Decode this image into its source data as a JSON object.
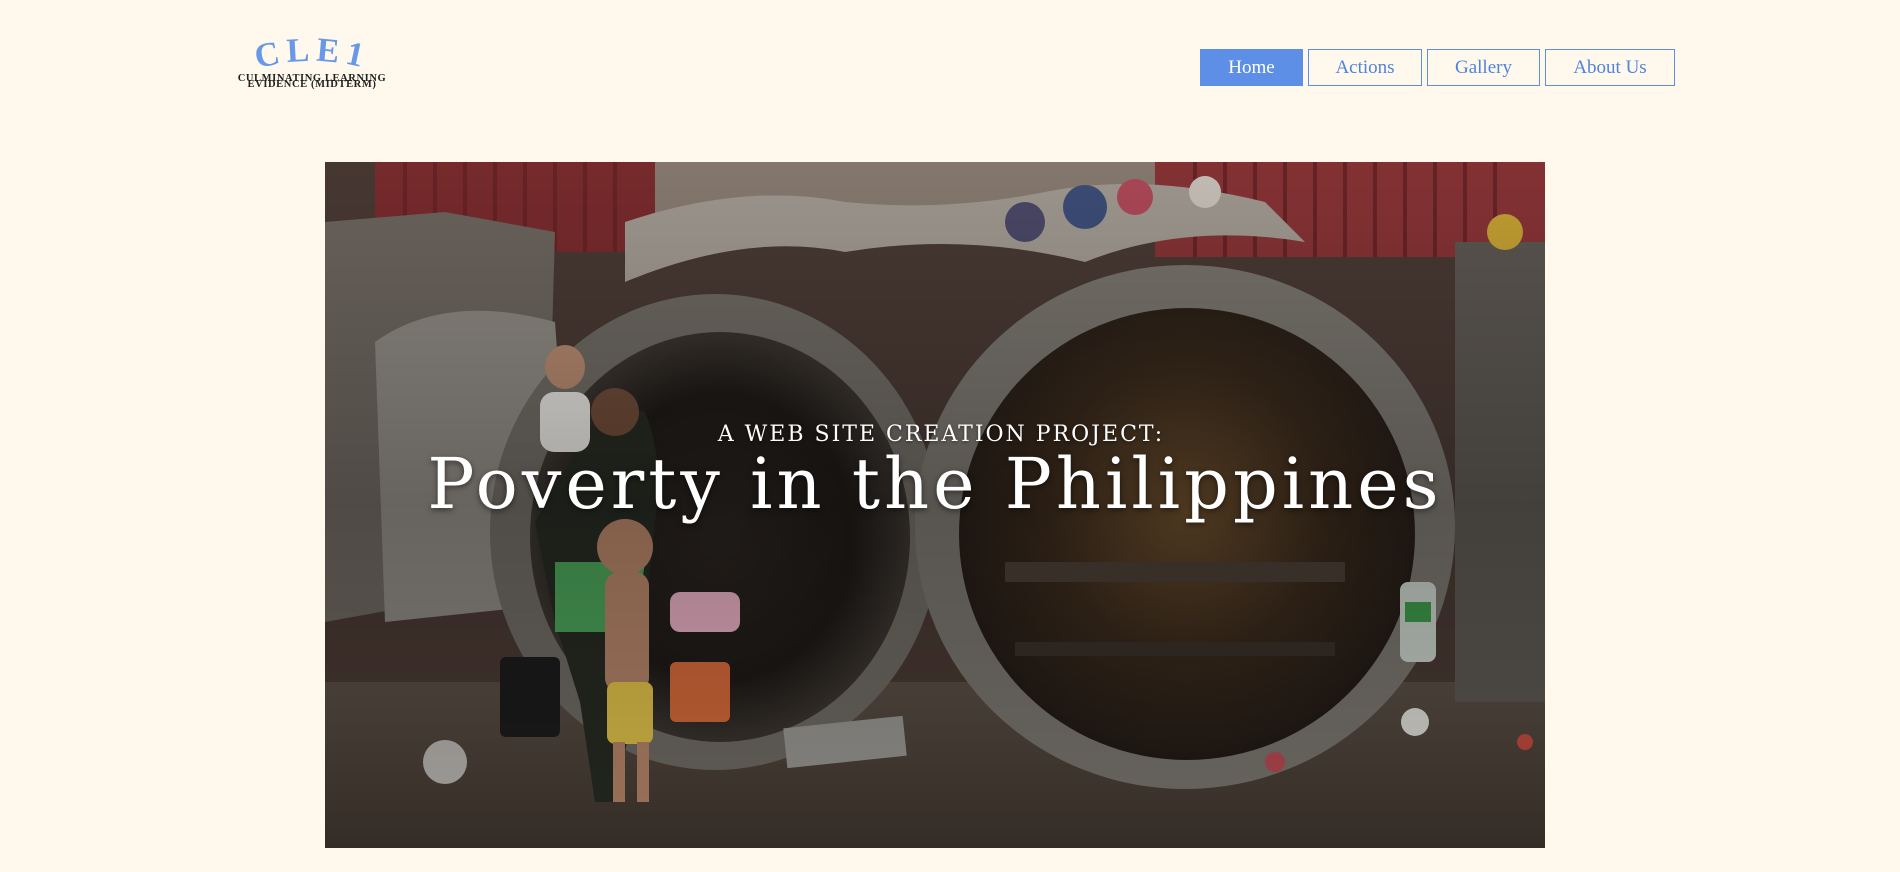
{
  "logo": {
    "mark": "CLE1",
    "subtitle_line1": "CULMINATING LEARNING",
    "subtitle_line2": "EVIDENCE (MIDTERM)"
  },
  "nav": {
    "items": [
      {
        "label": "Home",
        "active": true
      },
      {
        "label": "Actions",
        "active": false
      },
      {
        "label": "Gallery",
        "active": false
      },
      {
        "label": "About Us",
        "active": false
      }
    ]
  },
  "hero": {
    "subtitle": "A WEB SITE CREATION PROJECT:",
    "title": "Poverty in the Philippines",
    "image_alt": "Family living inside concrete culvert pipes"
  },
  "colors": {
    "background": "#fef9ec",
    "accent": "#5e8fe6",
    "logo_blue": "#6a98e8"
  }
}
